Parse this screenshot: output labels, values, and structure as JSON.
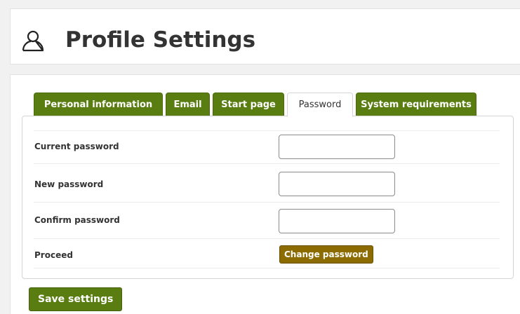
{
  "header": {
    "title": "Profile Settings",
    "icon": "user-profile-icon"
  },
  "tabs": [
    {
      "label": "Personal information",
      "active": false
    },
    {
      "label": "Email",
      "active": false
    },
    {
      "label": "Start page",
      "active": false
    },
    {
      "label": "Password",
      "active": true
    },
    {
      "label": "System requirements",
      "active": false
    }
  ],
  "form": {
    "current_password_label": "Current password",
    "current_password_value": "",
    "new_password_label": "New password",
    "new_password_value": "",
    "confirm_password_label": "Confirm password",
    "confirm_password_value": "",
    "proceed_label": "Proceed",
    "change_password_button": "Change password"
  },
  "actions": {
    "save_settings": "Save settings"
  },
  "colors": {
    "tab_green": "#5a7d12",
    "change_button_brown": "#8c6c00",
    "save_button_green": "#5a7d12"
  }
}
